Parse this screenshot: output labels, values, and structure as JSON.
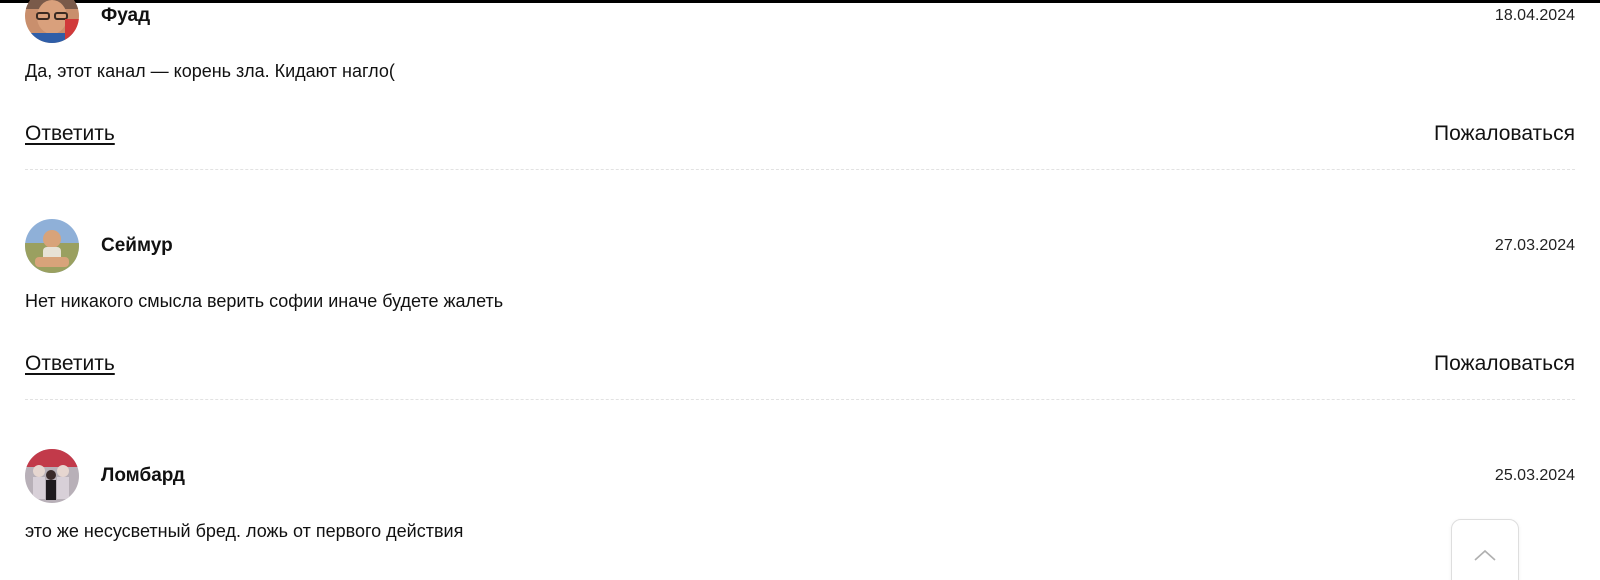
{
  "comments": [
    {
      "author": "Фуад",
      "date": "18.04.2024",
      "text": "Да, этот канал — корень зла. Кидают нагло(",
      "reply_label": "Ответить",
      "report_label": "Пожаловаться"
    },
    {
      "author": "Сеймур",
      "date": "27.03.2024",
      "text": "Нет никакого смысла верить софии иначе будете жалеть",
      "reply_label": "Ответить",
      "report_label": "Пожаловаться"
    },
    {
      "author": "Ломбард",
      "date": "25.03.2024",
      "text": "это же несусветный бред. ложь от первого действия"
    }
  ],
  "scroll_top_icon": "chevron-up-icon"
}
